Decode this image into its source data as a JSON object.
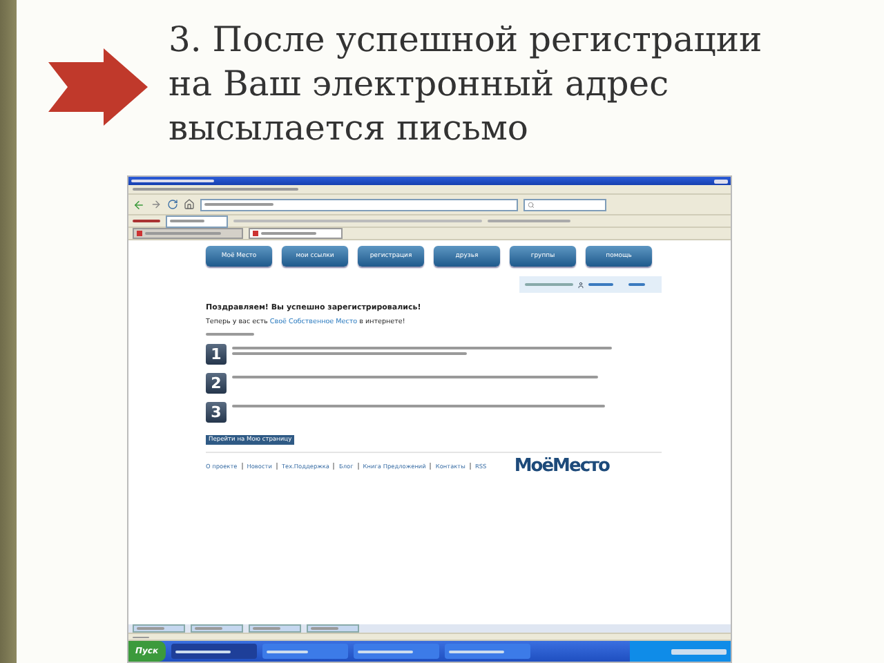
{
  "slide": {
    "title": "3. После успешной регистрации на Ваш электронный адрес высылается письмо"
  },
  "browser": {
    "tabs": [
      {
        "selected": false
      },
      {
        "selected": true
      }
    ],
    "nav": [
      "Моё Место",
      "мои ссылки",
      "регистрация",
      "друзья",
      "группы",
      "помощь"
    ],
    "heading": "Поздравляем! Вы успешно зарегистрировались!",
    "subheading": "Теперь у вас есть **Своё Собственное Место** в интернете!",
    "steps": [
      {
        "number": "1"
      },
      {
        "number": "2"
      },
      {
        "number": "3"
      }
    ],
    "button": "Перейти на Мою страницу",
    "footer_links": [
      "О проекте",
      "Новости",
      "Тех.Поддержка",
      "Блог",
      "Книга Предложений",
      "Контакты",
      "RSS"
    ],
    "logo": "МоёМесто",
    "start": "Пуск"
  }
}
